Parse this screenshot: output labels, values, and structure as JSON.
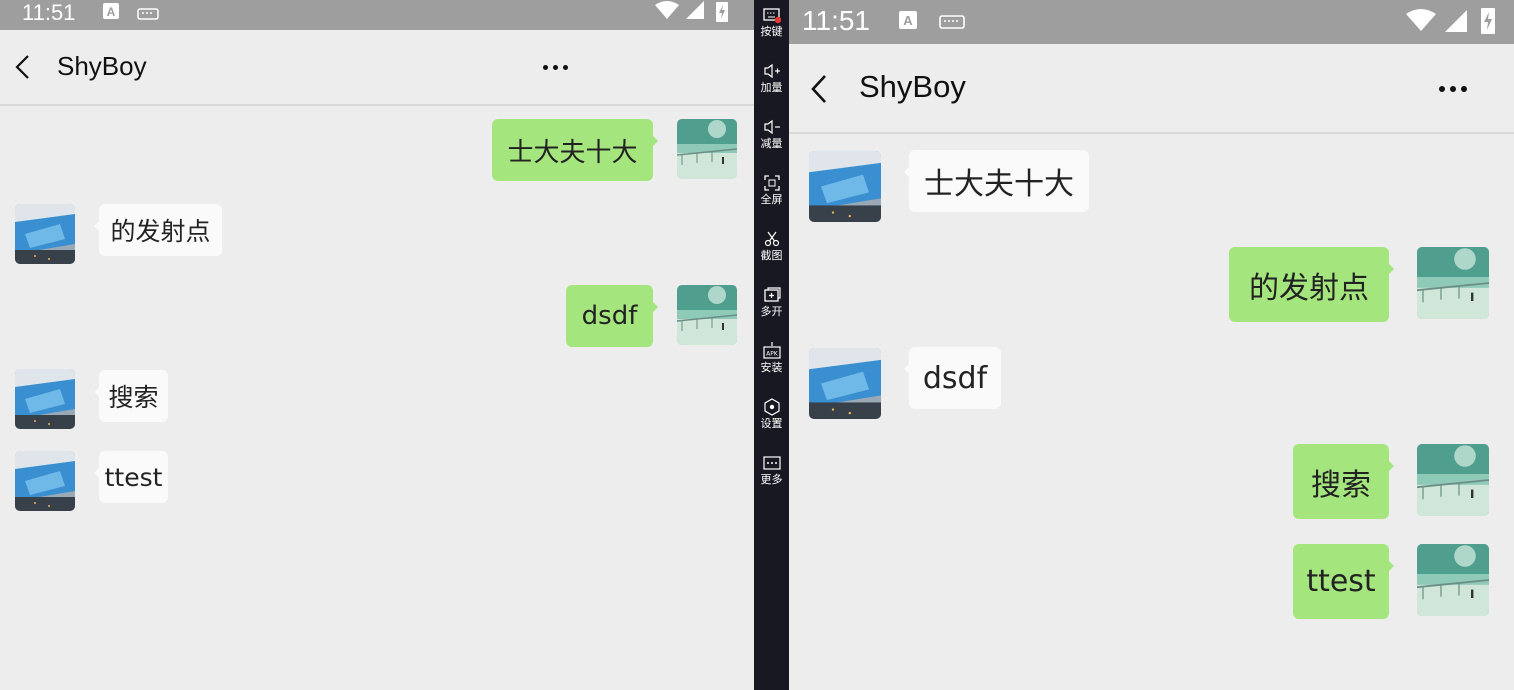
{
  "status": {
    "time": "11:51"
  },
  "chat": {
    "title": "ShyBoy",
    "left_messages": [
      {
        "text": "士大夫十大",
        "side": "sent"
      },
      {
        "text": "的发射点",
        "side": "recv"
      },
      {
        "text": "dsdf",
        "side": "sent"
      },
      {
        "text": "搜索",
        "side": "recv"
      },
      {
        "text": "ttest",
        "side": "recv"
      }
    ],
    "right_messages": [
      {
        "text": "士大夫十大",
        "side": "recv"
      },
      {
        "text": "的发射点",
        "side": "sent"
      },
      {
        "text": "dsdf",
        "side": "recv"
      },
      {
        "text": "搜索",
        "side": "sent"
      },
      {
        "text": "ttest",
        "side": "sent"
      }
    ]
  },
  "toolbar": {
    "items": [
      {
        "label": "按键",
        "icon": "keyboard-icon"
      },
      {
        "label": "加量",
        "icon": "volume-up-icon"
      },
      {
        "label": "减量",
        "icon": "volume-down-icon"
      },
      {
        "label": "全屏",
        "icon": "fullscreen-icon"
      },
      {
        "label": "截图",
        "icon": "scissors-icon"
      },
      {
        "label": "多开",
        "icon": "multi-instance-icon"
      },
      {
        "label": "安装",
        "icon": "apk-install-icon"
      },
      {
        "label": "设置",
        "icon": "settings-icon"
      },
      {
        "label": "更多",
        "icon": "more-icon"
      }
    ]
  },
  "colors": {
    "background": "#ededed",
    "status_bar": "#9e9e9e",
    "sent_bubble": "#a4e67d",
    "received_bubble": "#fafafa",
    "toolbar": "#171821"
  }
}
